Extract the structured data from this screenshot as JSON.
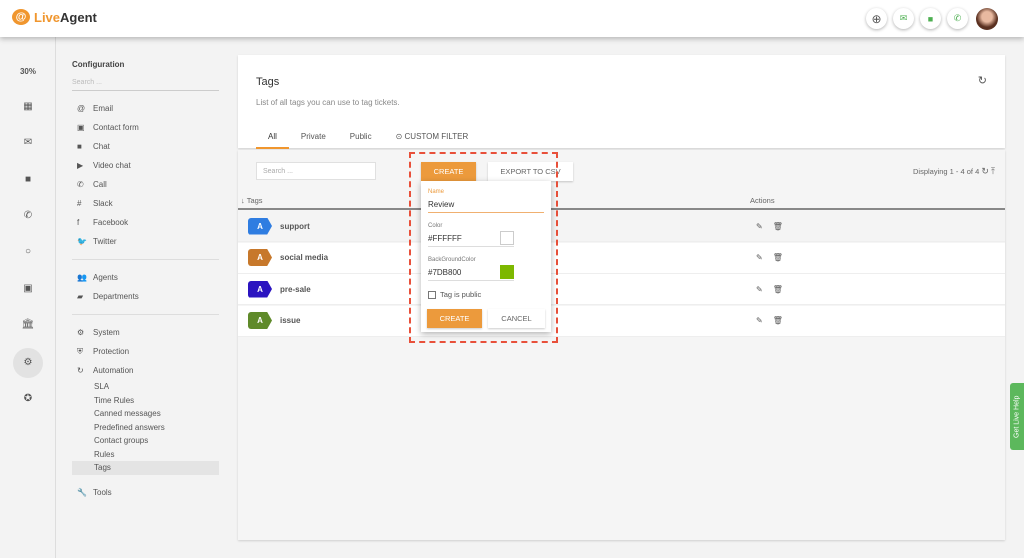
{
  "app": {
    "name_part1": "Live",
    "name_part2": "Agent"
  },
  "topbar": {
    "icons": [
      "plus-circle-icon",
      "email-icon",
      "chat-icon",
      "phone-icon"
    ]
  },
  "rail": {
    "percent": "30%"
  },
  "config": {
    "title": "Configuration",
    "search_placeholder": "Search ...",
    "channels": [
      {
        "icon": "@",
        "label": "Email"
      },
      {
        "icon": "▣",
        "label": "Contact form"
      },
      {
        "icon": "■",
        "label": "Chat"
      },
      {
        "icon": "▶",
        "label": "Video chat"
      },
      {
        "icon": "✆",
        "label": "Call"
      },
      {
        "icon": "#",
        "label": "Slack"
      },
      {
        "icon": "f",
        "label": "Facebook"
      },
      {
        "icon": "🐦",
        "label": "Twitter"
      }
    ],
    "people": [
      {
        "icon": "👥",
        "label": "Agents"
      },
      {
        "icon": "▰",
        "label": "Departments"
      }
    ],
    "system": [
      {
        "icon": "⚙",
        "label": "System"
      },
      {
        "icon": "⛨",
        "label": "Protection"
      },
      {
        "icon": "↻",
        "label": "Automation"
      }
    ],
    "automation": [
      "SLA",
      "Time Rules",
      "Canned messages",
      "Predefined answers",
      "Contact groups",
      "Rules",
      "Tags"
    ],
    "tools": "Tools"
  },
  "page": {
    "title": "Tags",
    "description": "List of all tags you can use to tag tickets.",
    "tabs": [
      "All",
      "Private",
      "Public",
      "⊙ CUSTOM FILTER"
    ],
    "search_placeholder": "Search ...",
    "create_label": "CREATE",
    "export_label": "EXPORT TO CSV",
    "displaying": "Displaying 1 - 4 of 4",
    "col_tags": "↓ Tags",
    "col_actions": "Actions",
    "tags": [
      {
        "letter": "A",
        "name": "support",
        "color": "#2f7de1"
      },
      {
        "letter": "A",
        "name": "social media",
        "color": "#c7782b"
      },
      {
        "letter": "A",
        "name": "pre-sale",
        "color": "#2b14c0"
      },
      {
        "letter": "A",
        "name": "issue",
        "color": "#5f8a2a"
      }
    ]
  },
  "popup": {
    "name_label": "Name",
    "name_value": "Review",
    "color_label": "Color",
    "color_value": "#FFFFFF",
    "bg_label": "BackGroundColor",
    "bg_value": "#7DB800",
    "public_label": "Tag is public",
    "public_checked": false,
    "create": "CREATE",
    "cancel": "CANCEL"
  },
  "help": "Get Live Help"
}
